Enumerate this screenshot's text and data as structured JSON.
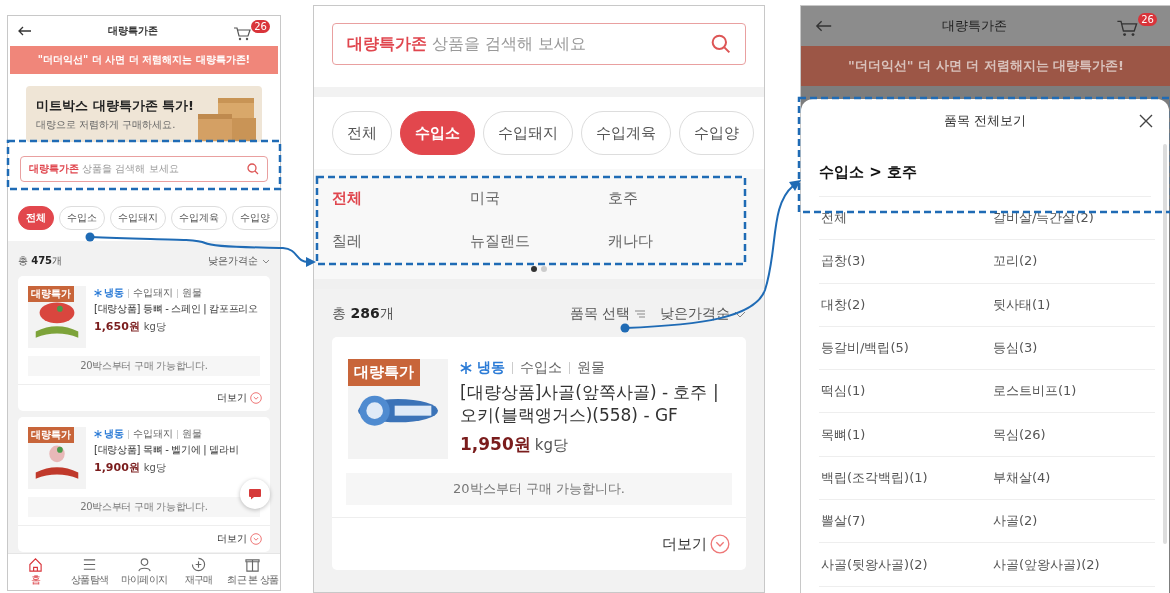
{
  "screen_home": {
    "header": {
      "title": "대량특가존",
      "cart_count": "26"
    },
    "promo": "\"더더익선\" 더 사면 더 저렴해지는 대량특가존!",
    "banner": {
      "title": "미트박스 대량특가존 특가!",
      "subtitle": "대량으로 저렴하게 구매하세요."
    },
    "search": {
      "placeholder": "**대량특가존** 상품을 검색해 보세요"
    },
    "chips": [
      {
        "label": "전체",
        "selected": true
      },
      {
        "label": "수입소",
        "selected": false
      },
      {
        "label": "수입돼지",
        "selected": false
      },
      {
        "label": "수입계육",
        "selected": false
      },
      {
        "label": "수입양",
        "selected": false
      }
    ],
    "total": "총 **475**개",
    "sort": "낮은가격순",
    "products": [
      {
        "badge": "대량특가",
        "storage": "냉동",
        "category": "수입돼지",
        "type": "원물",
        "name": "[대량상품] 등뼈 - 스페인 | 캄포프리오",
        "price": "1,650원",
        "unit": "kg당",
        "notice": "20박스부터 구매 가능합니다.",
        "more": "더보기"
      },
      {
        "badge": "대량특가",
        "storage": "냉동",
        "category": "수입돼지",
        "type": "원물",
        "name": "[대량상품] 목뼈 - 벨기에 | 델라비",
        "price": "1,900원",
        "unit": "kg당",
        "notice": "20박스부터 구매 가능합니다.",
        "more": "더보기"
      }
    ],
    "nav": [
      {
        "label": "홈",
        "selected": true
      },
      {
        "label": "상품탐색",
        "selected": false
      },
      {
        "label": "마이페이지",
        "selected": false
      },
      {
        "label": "재구매",
        "selected": false
      },
      {
        "label": "최근 본 상품",
        "selected": false
      }
    ]
  },
  "screen_filter": {
    "search": {
      "placeholder": "**대량특가존** 상품을 검색해 보세요"
    },
    "chips": [
      {
        "label": "전체",
        "selected": false
      },
      {
        "label": "수입소",
        "selected": true
      },
      {
        "label": "수입돼지",
        "selected": false
      },
      {
        "label": "수입계육",
        "selected": false
      },
      {
        "label": "수입양",
        "selected": false
      }
    ],
    "subcategories": [
      {
        "label": "전체",
        "selected": true
      },
      {
        "label": "미국",
        "selected": false
      },
      {
        "label": "호주",
        "selected": false
      },
      {
        "label": "칠레",
        "selected": false
      },
      {
        "label": "뉴질랜드",
        "selected": false
      },
      {
        "label": "캐나다",
        "selected": false
      }
    ],
    "pages": [
      {
        "selected": true
      },
      {
        "selected": false
      }
    ],
    "total": "총 **286**개",
    "filter": "품목 선택",
    "sort": "낮은가격순",
    "products": [
      {
        "badge": "대량특가",
        "storage": "냉동",
        "category": "수입소",
        "type": "원물",
        "name": "[대량상품]사골(앞쪽사골) - 호주 | 오키(블랙앵거스)(558) - GF",
        "price": "1,950원",
        "unit": "kg당",
        "notice": "20박스부터 구매 가능합니다.",
        "more": "더보기"
      }
    ]
  },
  "screen_sheet": {
    "header": {
      "title": "대량특가존",
      "cart_count": "26"
    },
    "promo": "\"더더익선\" 더 사면 더 저렴해지는 대량특가존!",
    "sheet": {
      "title": "품목 전체보기",
      "breadcrumb": "수입소 > 호주",
      "items": [
        "전체",
        "갈비살/늑간살(2)",
        "곱창(3)",
        "꼬리(2)",
        "대창(2)",
        "뒷사태(1)",
        "등갈비/백립(5)",
        "등심(3)",
        "떡심(1)",
        "로스트비프(1)",
        "목뼈(1)",
        "목심(26)",
        "백립(조각백립)(1)",
        "부채살(4)",
        "뽈살(7)",
        "사골(2)",
        "사골(뒷왕사골)(2)",
        "사골(앞왕사골)(2)"
      ]
    }
  }
}
